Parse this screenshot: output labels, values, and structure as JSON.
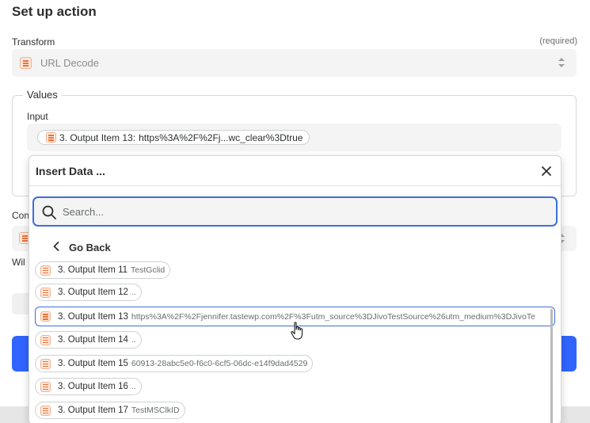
{
  "page": {
    "title": "Set up action"
  },
  "transform": {
    "label": "Transform",
    "required": "(required)",
    "selected": "URL Decode",
    "icon": "formatter-app-icon"
  },
  "values": {
    "legend": "Values",
    "input_label": "Input",
    "input_pill_key": "3. Output Item 13:",
    "input_pill_value": "https%3A%2F%2Fj...wc_clear%3Dtrue"
  },
  "background": {
    "partial_label_1": "Con",
    "partial_label_2": "Wil"
  },
  "insert_data": {
    "title": "Insert Data ...",
    "search_placeholder": "Search...",
    "go_back": "Go Back",
    "items": [
      {
        "key": "3. Output Item 11",
        "value": "TestGclid"
      },
      {
        "key": "3. Output Item 12",
        "value": ".."
      },
      {
        "key": "3. Output Item 13",
        "value": "https%3A%2F%2Fjennifer.tastewp.com%2F%3Futm_source%3DJivoTestSource%26utm_medium%3DJivoTe"
      },
      {
        "key": "3. Output Item 14",
        "value": ".."
      },
      {
        "key": "3. Output Item 15",
        "value": "60913-28abc5e0-f6c0-6cf5-06dc-e14f9dad4529"
      },
      {
        "key": "3. Output Item 16",
        "value": ".."
      },
      {
        "key": "3. Output Item 17",
        "value": "TestMSClkID"
      }
    ]
  },
  "colors": {
    "accent": "#3d6fd9",
    "primary_button": "#3164ff",
    "app_icon": "#e8733c"
  }
}
